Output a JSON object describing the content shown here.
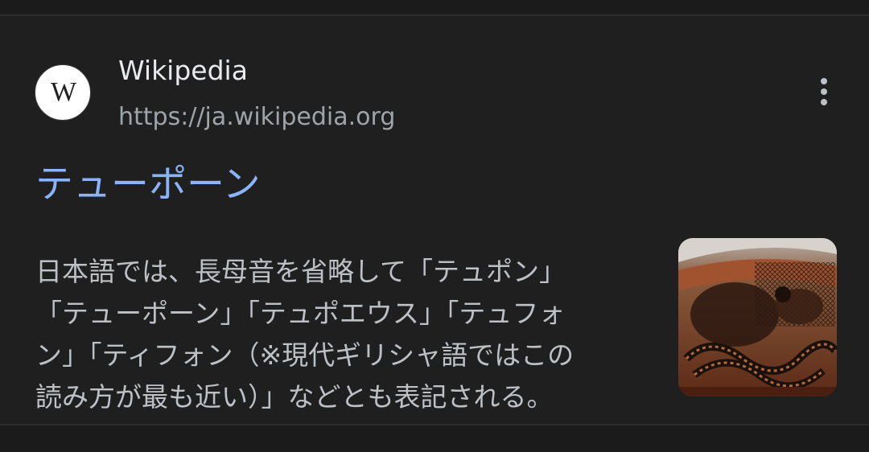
{
  "result": {
    "site_name": "Wikipedia",
    "site_url": "https://ja.wikipedia.org",
    "favicon_letter": "W",
    "title": "テューポーン",
    "snippet_lines": [
      "日本語では、長母音を省略して「テュポン」",
      "「テューポーン」「テュポエウス」「テュフォ",
      "ン」「ティフォン（※現代ギリシャ語ではこの",
      "読み方が最も近い）」などとも表記される。"
    ],
    "more_options_icon": "more-vert-icon",
    "thumbnail_icon": "greek-vase-image"
  },
  "colors": {
    "background": "#1f1f1f",
    "title_link": "#8ab4f8",
    "site_name": "#e8eaed",
    "url": "#a0a4a8",
    "snippet": "#bdc1c6"
  }
}
